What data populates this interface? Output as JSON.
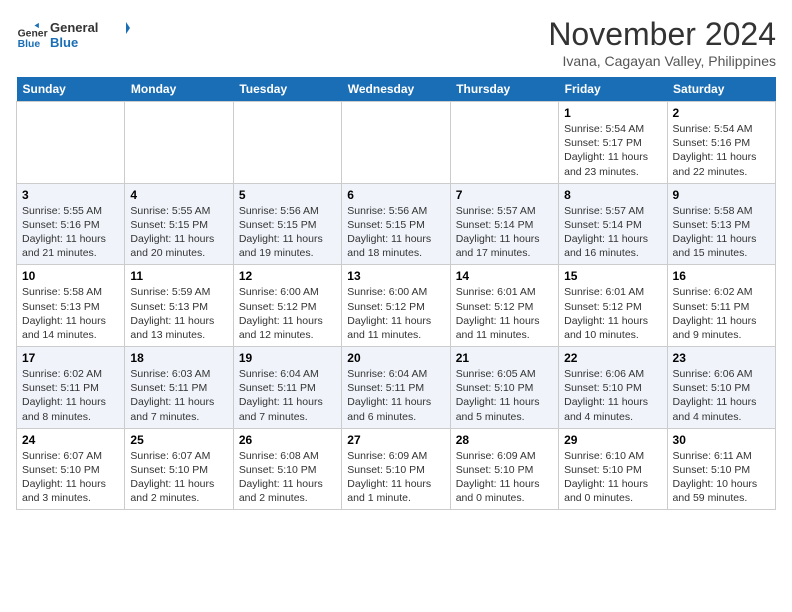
{
  "header": {
    "logo_line1": "General",
    "logo_line2": "Blue",
    "month": "November 2024",
    "location": "Ivana, Cagayan Valley, Philippines"
  },
  "weekdays": [
    "Sunday",
    "Monday",
    "Tuesday",
    "Wednesday",
    "Thursday",
    "Friday",
    "Saturday"
  ],
  "weeks": [
    [
      {
        "day": "",
        "info": ""
      },
      {
        "day": "",
        "info": ""
      },
      {
        "day": "",
        "info": ""
      },
      {
        "day": "",
        "info": ""
      },
      {
        "day": "",
        "info": ""
      },
      {
        "day": "1",
        "info": "Sunrise: 5:54 AM\nSunset: 5:17 PM\nDaylight: 11 hours and 23 minutes."
      },
      {
        "day": "2",
        "info": "Sunrise: 5:54 AM\nSunset: 5:16 PM\nDaylight: 11 hours and 22 minutes."
      }
    ],
    [
      {
        "day": "3",
        "info": "Sunrise: 5:55 AM\nSunset: 5:16 PM\nDaylight: 11 hours and 21 minutes."
      },
      {
        "day": "4",
        "info": "Sunrise: 5:55 AM\nSunset: 5:15 PM\nDaylight: 11 hours and 20 minutes."
      },
      {
        "day": "5",
        "info": "Sunrise: 5:56 AM\nSunset: 5:15 PM\nDaylight: 11 hours and 19 minutes."
      },
      {
        "day": "6",
        "info": "Sunrise: 5:56 AM\nSunset: 5:15 PM\nDaylight: 11 hours and 18 minutes."
      },
      {
        "day": "7",
        "info": "Sunrise: 5:57 AM\nSunset: 5:14 PM\nDaylight: 11 hours and 17 minutes."
      },
      {
        "day": "8",
        "info": "Sunrise: 5:57 AM\nSunset: 5:14 PM\nDaylight: 11 hours and 16 minutes."
      },
      {
        "day": "9",
        "info": "Sunrise: 5:58 AM\nSunset: 5:13 PM\nDaylight: 11 hours and 15 minutes."
      }
    ],
    [
      {
        "day": "10",
        "info": "Sunrise: 5:58 AM\nSunset: 5:13 PM\nDaylight: 11 hours and 14 minutes."
      },
      {
        "day": "11",
        "info": "Sunrise: 5:59 AM\nSunset: 5:13 PM\nDaylight: 11 hours and 13 minutes."
      },
      {
        "day": "12",
        "info": "Sunrise: 6:00 AM\nSunset: 5:12 PM\nDaylight: 11 hours and 12 minutes."
      },
      {
        "day": "13",
        "info": "Sunrise: 6:00 AM\nSunset: 5:12 PM\nDaylight: 11 hours and 11 minutes."
      },
      {
        "day": "14",
        "info": "Sunrise: 6:01 AM\nSunset: 5:12 PM\nDaylight: 11 hours and 11 minutes."
      },
      {
        "day": "15",
        "info": "Sunrise: 6:01 AM\nSunset: 5:12 PM\nDaylight: 11 hours and 10 minutes."
      },
      {
        "day": "16",
        "info": "Sunrise: 6:02 AM\nSunset: 5:11 PM\nDaylight: 11 hours and 9 minutes."
      }
    ],
    [
      {
        "day": "17",
        "info": "Sunrise: 6:02 AM\nSunset: 5:11 PM\nDaylight: 11 hours and 8 minutes."
      },
      {
        "day": "18",
        "info": "Sunrise: 6:03 AM\nSunset: 5:11 PM\nDaylight: 11 hours and 7 minutes."
      },
      {
        "day": "19",
        "info": "Sunrise: 6:04 AM\nSunset: 5:11 PM\nDaylight: 11 hours and 7 minutes."
      },
      {
        "day": "20",
        "info": "Sunrise: 6:04 AM\nSunset: 5:11 PM\nDaylight: 11 hours and 6 minutes."
      },
      {
        "day": "21",
        "info": "Sunrise: 6:05 AM\nSunset: 5:10 PM\nDaylight: 11 hours and 5 minutes."
      },
      {
        "day": "22",
        "info": "Sunrise: 6:06 AM\nSunset: 5:10 PM\nDaylight: 11 hours and 4 minutes."
      },
      {
        "day": "23",
        "info": "Sunrise: 6:06 AM\nSunset: 5:10 PM\nDaylight: 11 hours and 4 minutes."
      }
    ],
    [
      {
        "day": "24",
        "info": "Sunrise: 6:07 AM\nSunset: 5:10 PM\nDaylight: 11 hours and 3 minutes."
      },
      {
        "day": "25",
        "info": "Sunrise: 6:07 AM\nSunset: 5:10 PM\nDaylight: 11 hours and 2 minutes."
      },
      {
        "day": "26",
        "info": "Sunrise: 6:08 AM\nSunset: 5:10 PM\nDaylight: 11 hours and 2 minutes."
      },
      {
        "day": "27",
        "info": "Sunrise: 6:09 AM\nSunset: 5:10 PM\nDaylight: 11 hours and 1 minute."
      },
      {
        "day": "28",
        "info": "Sunrise: 6:09 AM\nSunset: 5:10 PM\nDaylight: 11 hours and 0 minutes."
      },
      {
        "day": "29",
        "info": "Sunrise: 6:10 AM\nSunset: 5:10 PM\nDaylight: 11 hours and 0 minutes."
      },
      {
        "day": "30",
        "info": "Sunrise: 6:11 AM\nSunset: 5:10 PM\nDaylight: 10 hours and 59 minutes."
      }
    ]
  ]
}
